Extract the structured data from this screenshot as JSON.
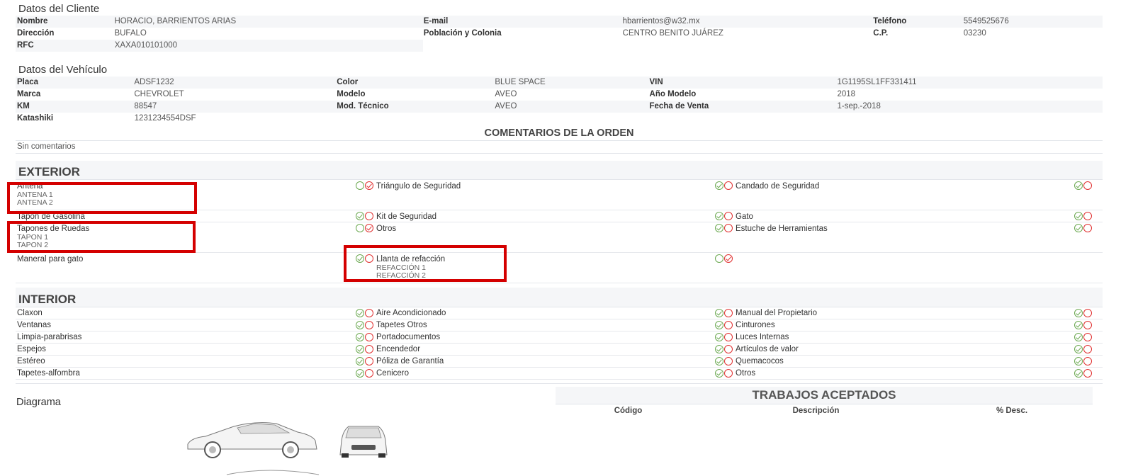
{
  "cliente": {
    "title": "Datos del Cliente",
    "rows": [
      [
        [
          "Nombre",
          "HORACIO, BARRIENTOS ARIAS"
        ],
        [
          "E-mail",
          "hbarrientos@w32.mx"
        ],
        [
          "Teléfono",
          "5549525676"
        ]
      ],
      [
        [
          "Dirección",
          "BUFALO"
        ],
        [
          "Población y Colonia",
          "CENTRO BENITO JUÁREZ"
        ],
        [
          "C.P.",
          "03230"
        ]
      ],
      [
        [
          "RFC",
          "XAXA010101000"
        ]
      ]
    ]
  },
  "vehiculo": {
    "title": "Datos del Vehículo",
    "rows": [
      [
        [
          "Placa",
          "ADSF1232"
        ],
        [
          "Color",
          "BLUE SPACE"
        ],
        [
          "VIN",
          "1G1195SL1FF331411"
        ]
      ],
      [
        [
          "Marca",
          "CHEVROLET"
        ],
        [
          "Modelo",
          "AVEO"
        ],
        [
          "Año Modelo",
          "2018"
        ]
      ],
      [
        [
          "KM",
          "88547"
        ],
        [
          "Mod. Técnico",
          "AVEO"
        ],
        [
          "Fecha de Venta",
          "1-sep.-2018"
        ]
      ],
      [
        [
          "Katashiki",
          "1231234554DSF"
        ]
      ]
    ]
  },
  "comentarios": {
    "title": "COMENTARIOS DE LA ORDEN",
    "text": "Sin comentarios"
  },
  "exterior": {
    "title": "EXTERIOR",
    "rows": [
      [
        {
          "name": "Antena",
          "subs": [
            "ANTENA 1",
            "ANTENA 2"
          ],
          "ok": false,
          "bad": true
        },
        {
          "name": "Triángulo de Seguridad",
          "subs": [],
          "ok": true,
          "bad": false
        },
        {
          "name": "Candado de Seguridad",
          "subs": [],
          "ok": true,
          "bad": false
        }
      ],
      [
        {
          "name": "Tapón de Gasolina",
          "subs": [],
          "ok": true,
          "bad": false
        },
        {
          "name": "Kit de Seguridad",
          "subs": [],
          "ok": true,
          "bad": false
        },
        {
          "name": "Gato",
          "subs": [],
          "ok": true,
          "bad": false
        }
      ],
      [
        {
          "name": "Tapones de Ruedas",
          "subs": [
            "TAPON 1",
            "TAPON 2"
          ],
          "ok": false,
          "bad": true
        },
        {
          "name": "Otros",
          "subs": [],
          "ok": true,
          "bad": false
        },
        {
          "name": "Estuche de Herramientas",
          "subs": [],
          "ok": true,
          "bad": false
        }
      ],
      [
        {
          "name": "Maneral para gato",
          "subs": [],
          "ok": true,
          "bad": false
        },
        {
          "name": "Llanta de refacción",
          "subs": [
            "REFACCIÓN 1",
            "REFACCIÓN 2"
          ],
          "ok": false,
          "bad": true
        }
      ]
    ]
  },
  "interior": {
    "title": "INTERIOR",
    "rows": [
      [
        "Claxon",
        "Aire Acondicionado",
        "Manual del Propietario"
      ],
      [
        "Ventanas",
        "Tapetes Otros",
        "Cinturones"
      ],
      [
        "Limpia-parabrisas",
        "Portadocumentos",
        "Luces Internas"
      ],
      [
        "Espejos",
        "Encendedor",
        "Artículos de valor"
      ],
      [
        "Estéreo",
        "Póliza de Garantía",
        "Quemacocos"
      ],
      [
        "Tapetes-alfombra",
        "Cenicero",
        "Otros"
      ]
    ]
  },
  "diagrama": {
    "title": "Diagrama"
  },
  "trabajos": {
    "title": "TRABAJOS ACEPTADOS",
    "columns": [
      "Código",
      "Descripción",
      "% Desc."
    ]
  },
  "colors": {
    "ok": "#6aa84f",
    "bad": "#e03030",
    "highlight": "#d40000"
  }
}
